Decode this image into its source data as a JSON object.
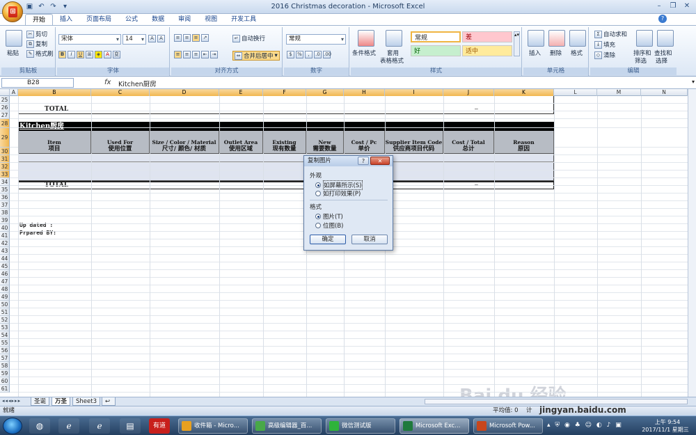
{
  "window": {
    "title": "2016 Christmas decoration - Microsoft Excel"
  },
  "ribbon": {
    "tabs": [
      "开始",
      "插入",
      "页面布局",
      "公式",
      "数据",
      "审阅",
      "视图",
      "开发工具"
    ],
    "clipboard": {
      "paste": "粘贴",
      "cut": "剪切",
      "copy": "复制",
      "format_painter": "格式刷",
      "label": "剪贴板"
    },
    "font": {
      "name": "宋体",
      "size": "14",
      "label": "字体"
    },
    "alignment": {
      "wrap": "自动换行",
      "merge": "合并后居中",
      "label": "对齐方式"
    },
    "number": {
      "format": "常规",
      "label": "数字"
    },
    "styles": {
      "conditional": "条件格式",
      "table_format_1": "套用",
      "table_format_2": "表格格式",
      "normal": "常规",
      "bad": "差",
      "good": "好",
      "neutral": "适中",
      "label": "样式"
    },
    "cells": {
      "insert": "插入",
      "delete": "删除",
      "format": "格式",
      "label": "单元格"
    },
    "editing": {
      "autosum": "自动求和",
      "fill": "填充",
      "clear": "清除",
      "sort": "排序和",
      "sort2": "筛选",
      "find": "查找和",
      "find2": "选择",
      "label": "编辑"
    }
  },
  "formula_bar": {
    "name_box": "B28",
    "fx": "fx",
    "content": "Kitchen厨房"
  },
  "columns": [
    "A",
    "B",
    "C",
    "D",
    "E",
    "F",
    "G",
    "H",
    "I",
    "J",
    "K",
    "L",
    "M",
    "N"
  ],
  "rows": [
    "25",
    "26",
    "27",
    "28",
    "29",
    "30",
    "31",
    "32",
    "33",
    "34",
    "35",
    "36",
    "37",
    "38",
    "39",
    "40",
    "41",
    "42",
    "43",
    "44",
    "45",
    "46",
    "47",
    "48",
    "49",
    "50",
    "51",
    "52",
    "53",
    "54",
    "55",
    "56",
    "57",
    "58",
    "59",
    "60",
    "61"
  ],
  "sheet": {
    "total_label": "TOTAL",
    "dash": "–",
    "kitchen_title": "Kitchen厨房",
    "headers": [
      {
        "en": "Item",
        "zh": "项目"
      },
      {
        "en": "Used For",
        "zh": "使用位置"
      },
      {
        "en": "Size  / Color / Material",
        "zh": "尺寸/ 颜色/ 材质"
      },
      {
        "en": "Outlet Area",
        "zh": "使用区域"
      },
      {
        "en": "Existing",
        "zh": "现有数量"
      },
      {
        "en": "New",
        "zh": "需要数量"
      },
      {
        "en": "Cost / Pc",
        "zh": "单价"
      },
      {
        "en": "Supplier Item Code",
        "zh": "供应商项目代码"
      },
      {
        "en": "Cost / Total",
        "zh": "总计"
      },
      {
        "en": "Reason",
        "zh": "原因"
      }
    ],
    "updated": "Up dated :",
    "prepared": "Prpared BY:"
  },
  "dialog": {
    "title": "复制图片",
    "help": "?",
    "close": "✕",
    "appearance": "外观",
    "opt_screen": "如屏幕所示(S)",
    "opt_print": "如打印效果(P)",
    "format": "格式",
    "opt_picture": "图片(T)",
    "opt_bitmap": "位图(B)",
    "ok": "确定",
    "cancel": "取消"
  },
  "sheet_tabs": [
    "圣诞",
    "万圣",
    "Sheet3"
  ],
  "status": {
    "ready": "就绪",
    "average": "平均值: 0",
    "count": "计"
  },
  "taskbar": {
    "items": [
      "收件箱 - Micro...",
      "高级编辑器_百...",
      "微信测试版",
      "Microsoft Exc...",
      "Microsoft Pow..."
    ],
    "pins": [
      "有道"
    ],
    "time": "上午 9:54",
    "date": "2017/11/1 星期三"
  },
  "watermark": "jingyan.baidu.com"
}
